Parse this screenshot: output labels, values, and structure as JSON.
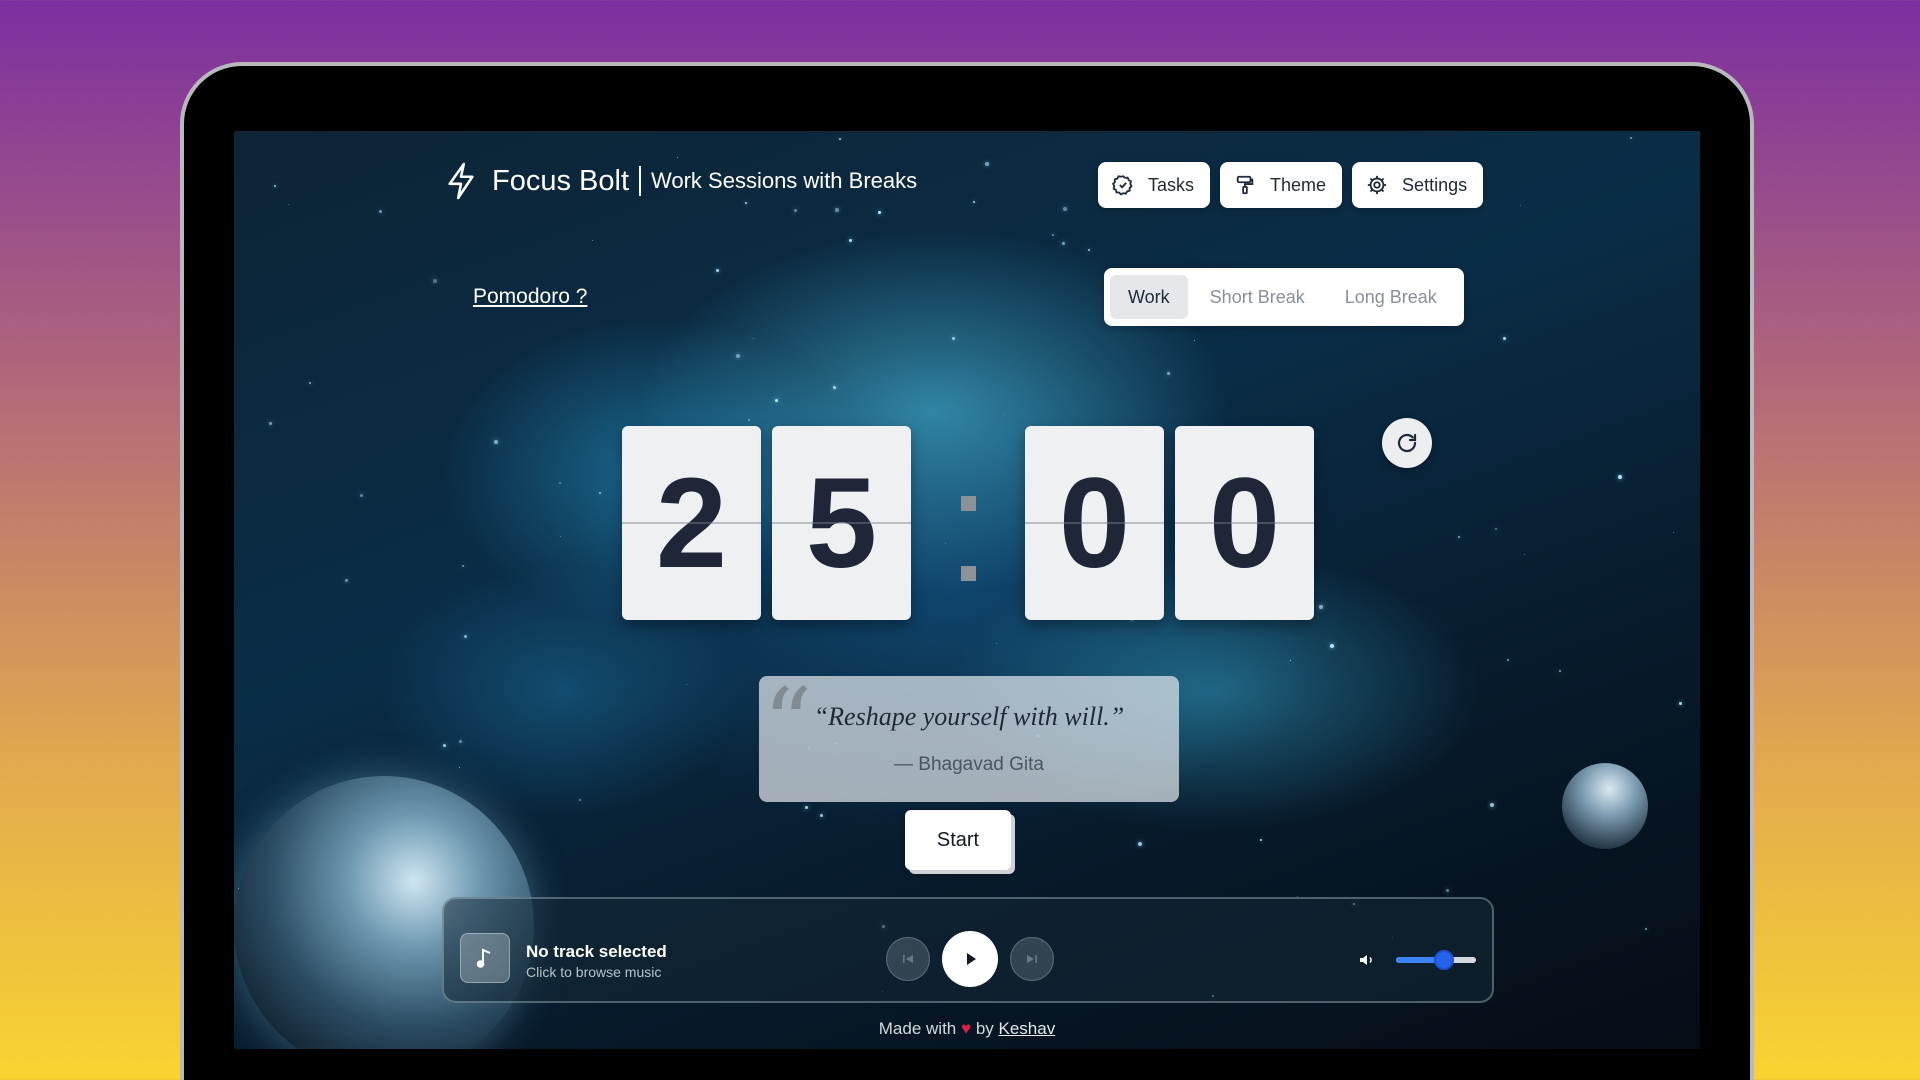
{
  "header": {
    "brand_name": "Focus Bolt",
    "tagline": "Work Sessions with Breaks",
    "buttons": [
      {
        "label": "Tasks",
        "icon": "check-circle-icon"
      },
      {
        "label": "Theme",
        "icon": "paint-roller-icon"
      },
      {
        "label": "Settings",
        "icon": "gear-icon"
      }
    ]
  },
  "pomodoro_link": "Pomodoro ?",
  "mode_tabs": {
    "items": [
      "Work",
      "Short Break",
      "Long Break"
    ],
    "active": "Work"
  },
  "timer": {
    "minutes_tens": "2",
    "minutes_ones": "5",
    "seconds_tens": "0",
    "seconds_ones": "0"
  },
  "quote": {
    "text": "“Reshape yourself with will.”",
    "author": "— Bhagavad Gita"
  },
  "start_label": "Start",
  "player": {
    "track_title": "No track selected",
    "track_subtitle": "Click to browse music",
    "volume_level": 0.6,
    "accent_color": "#3b82f6"
  },
  "footer": {
    "prefix": "Made with",
    "by": "by",
    "author": "Keshav"
  },
  "colors": {
    "background_top": "#7c2fa0",
    "background_bottom": "#f8d431",
    "digit_text": "#1e2638"
  }
}
